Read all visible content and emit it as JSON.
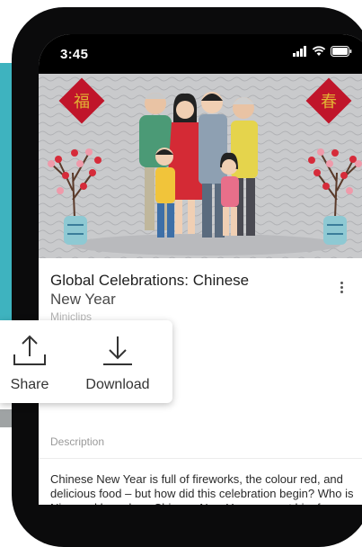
{
  "status_bar": {
    "time": "3:45"
  },
  "video": {
    "title_line1": "Global Celebrations: Chinese",
    "title_line2": "New Year",
    "channel": "Miniclips"
  },
  "share_menu": {
    "share_label": "Share",
    "download_label": "Download"
  },
  "description": {
    "label": "Description",
    "text": "Chinese New Year is full of fireworks, the colour red, and delicious food – but how did this celebration begin? Who is Nian and how does Chinese New Year prevent him from terrorising villages once mo..."
  },
  "colors": {
    "teal": "#3eb3bf",
    "accent_red": "#c0152a",
    "text_dark": "#1f1f1f",
    "text_muted": "#b3b3b3"
  },
  "icons": [
    "signal-icon",
    "wifi-icon",
    "battery-icon",
    "more-vert-icon",
    "share-icon",
    "download-icon"
  ]
}
